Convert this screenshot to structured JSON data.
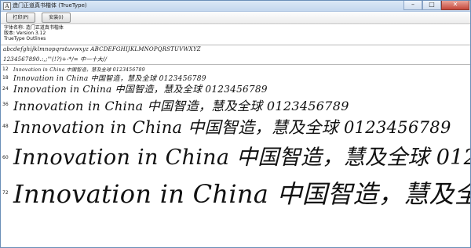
{
  "window": {
    "title": "造门正道真书楷体 (TrueType)",
    "app_icon_glyph": "A",
    "buttons": {
      "minimize": "–",
      "maximize": "□",
      "close": "✕"
    }
  },
  "toolbar": {
    "print_label": "打印(P)",
    "install_label": "安装(I)"
  },
  "info": {
    "font_name": "字体名称: 造门正道真书楷体",
    "version": "版本: Version 3.12",
    "type": "TrueType Outlines"
  },
  "charset": {
    "latin": "abcdefghijklmnopqrstuvwxyz ABCDEFGHIJKLMNOPQRSTUVWXYZ",
    "digits": "1234567890.:,;'\"(!?)+-*/= 中一十大//"
  },
  "sample_text": "Innovation in China 中国智造，慧及全球 0123456789",
  "samples": [
    {
      "size": "12"
    },
    {
      "size": "18"
    },
    {
      "size": "24"
    },
    {
      "size": "36"
    },
    {
      "size": "48"
    },
    {
      "size": "60"
    },
    {
      "size": "72"
    }
  ]
}
